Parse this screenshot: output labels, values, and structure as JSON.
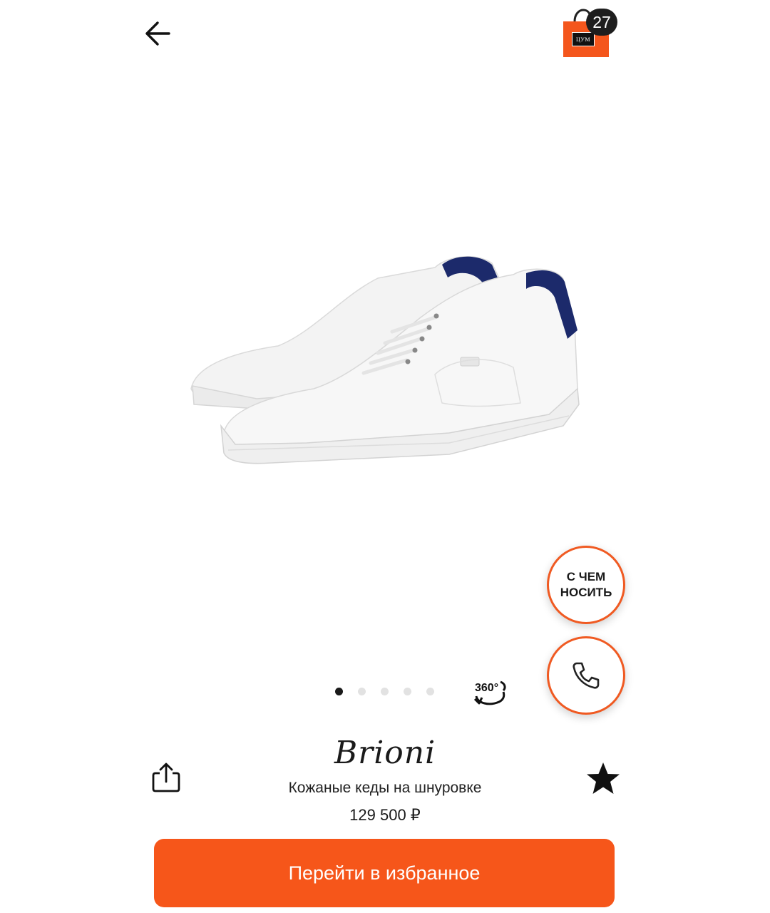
{
  "colors": {
    "accent": "#f6561a",
    "fab_border": "#f05a22",
    "badge_bg": "#1e1e1e",
    "text": "#1a1a1a",
    "dot_inactive": "#e2e2e2",
    "shoe_accent": "#1c2a6b"
  },
  "header": {
    "back_icon": "arrow-left-icon",
    "bag_icon": "shopping-bag-icon",
    "bag_logo_text": "ЦУМ",
    "bag_count": "27"
  },
  "gallery": {
    "image_subject": "white leather sneakers with navy heel tab",
    "slide_count": 5,
    "active_slide": 1,
    "view_360_label": "360°"
  },
  "floating_actions": {
    "outfit_label": "С ЧЕМ\nНОСИТЬ",
    "call_icon": "phone-icon"
  },
  "product": {
    "brand": "Brioni",
    "name": "Кожаные кеды на шнуровке",
    "price": "129 500 ₽",
    "share_icon": "share-icon",
    "favorite_icon": "star-icon",
    "favorite_active": true
  },
  "cta": {
    "label": "Перейти в избранное"
  }
}
